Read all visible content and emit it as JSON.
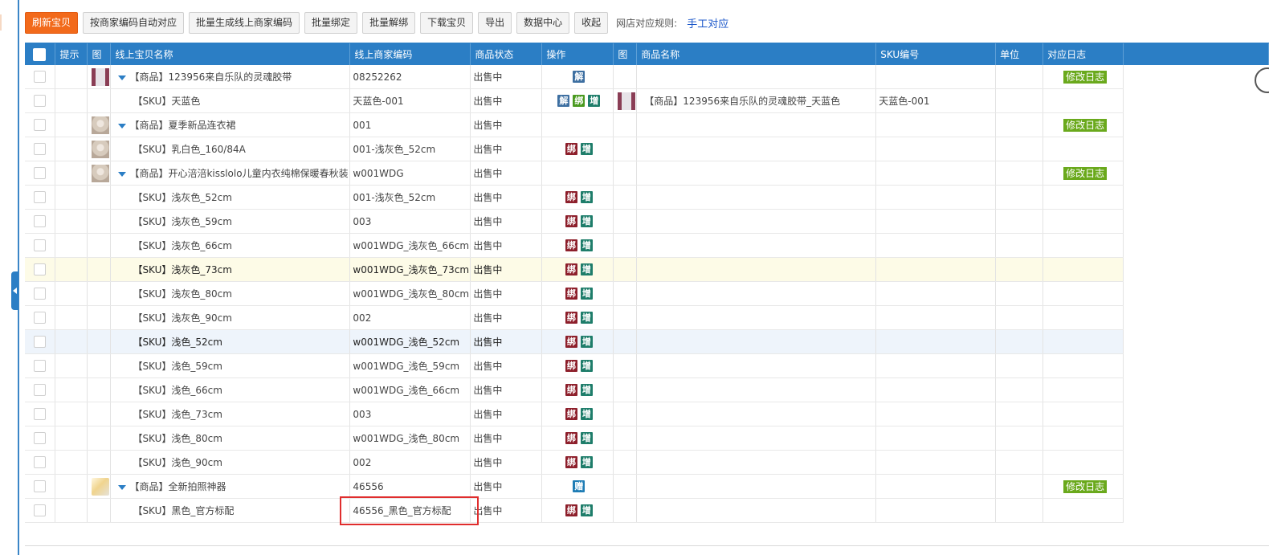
{
  "toolbar": {
    "refresh": "刷新宝贝",
    "auto_match": "按商家编码自动对应",
    "batch_generate": "批量生成线上商家编码",
    "batch_bind": "批量绑定",
    "batch_unbind": "批量解绑",
    "download": "下载宝贝",
    "export": "导出",
    "data_center": "数据中心",
    "collapse": "收起",
    "rule_label": "网店对应规则:",
    "rule_link": "手工对应"
  },
  "columns": [
    "提示",
    "图",
    "线上宝贝名称",
    "线上商家编码",
    "商品状态",
    "操作",
    "图",
    "商品名称",
    "SKU编号",
    "单位",
    "对应日志"
  ],
  "ops_labels": {
    "unbind": "解",
    "bind": "绑",
    "add": "增",
    "gift": "赠"
  },
  "log_label": "修改日志",
  "rows": [
    {
      "type": "product",
      "thumb": "tape",
      "name": "【商品】123956来自乐队的灵魂胶带",
      "code": "08252262",
      "status": "出售中",
      "ops": [
        "unbind"
      ],
      "pname": "",
      "sku": "",
      "log": true
    },
    {
      "type": "sku",
      "thumb": "",
      "name": "【SKU】天蓝色",
      "code": "天蓝色-001",
      "status": "出售中",
      "ops": [
        "unbind",
        "bind-green",
        "add"
      ],
      "pthumb": "tape",
      "pname": "【商品】123956来自乐队的灵魂胶带_天蓝色",
      "sku": "天蓝色-001",
      "log": false
    },
    {
      "type": "product",
      "thumb": "dress",
      "name": "【商品】夏季新品连衣裙",
      "code": "001",
      "status": "出售中",
      "ops": [],
      "pname": "",
      "sku": "",
      "log": true
    },
    {
      "type": "sku",
      "thumb": "dress",
      "name": "【SKU】乳白色_160/84A",
      "code": "001-浅灰色_52cm",
      "status": "出售中",
      "ops": [
        "bind",
        "add"
      ],
      "pname": "",
      "sku": "",
      "log": false
    },
    {
      "type": "product",
      "thumb": "dress",
      "name": "【商品】开心涪涪kisslolo儿童内衣纯棉保暖春秋装",
      "code": "w001WDG",
      "status": "出售中",
      "ops": [],
      "pname": "",
      "sku": "",
      "log": true
    },
    {
      "type": "sku",
      "thumb": "",
      "name": "【SKU】浅灰色_52cm",
      "code": "001-浅灰色_52cm",
      "status": "出售中",
      "ops": [
        "bind",
        "add"
      ],
      "pname": "",
      "sku": "",
      "log": false
    },
    {
      "type": "sku",
      "thumb": "",
      "name": "【SKU】浅灰色_59cm",
      "code": "003",
      "status": "出售中",
      "ops": [
        "bind",
        "add"
      ],
      "pname": "",
      "sku": "",
      "log": false
    },
    {
      "type": "sku",
      "thumb": "",
      "name": "【SKU】浅灰色_66cm",
      "code": "w001WDG_浅灰色_66cm",
      "status": "出售中",
      "ops": [
        "bind",
        "add"
      ],
      "pname": "",
      "sku": "",
      "log": false
    },
    {
      "type": "sku",
      "thumb": "",
      "name": "【SKU】浅灰色_73cm",
      "code": "w001WDG_浅灰色_73cm",
      "status": "出售中",
      "ops": [
        "bind",
        "add"
      ],
      "pname": "",
      "sku": "",
      "log": false,
      "state": "yellow"
    },
    {
      "type": "sku",
      "thumb": "",
      "name": "【SKU】浅灰色_80cm",
      "code": "w001WDG_浅灰色_80cm",
      "status": "出售中",
      "ops": [
        "bind",
        "add"
      ],
      "pname": "",
      "sku": "",
      "log": false
    },
    {
      "type": "sku",
      "thumb": "",
      "name": "【SKU】浅灰色_90cm",
      "code": "002",
      "status": "出售中",
      "ops": [
        "bind",
        "add"
      ],
      "pname": "",
      "sku": "",
      "log": false
    },
    {
      "type": "sku",
      "thumb": "",
      "name": "【SKU】浅色_52cm",
      "code": "w001WDG_浅色_52cm",
      "status": "出售中",
      "ops": [
        "bind",
        "add"
      ],
      "pname": "",
      "sku": "",
      "log": false,
      "state": "blue"
    },
    {
      "type": "sku",
      "thumb": "",
      "name": "【SKU】浅色_59cm",
      "code": "w001WDG_浅色_59cm",
      "status": "出售中",
      "ops": [
        "bind",
        "add"
      ],
      "pname": "",
      "sku": "",
      "log": false
    },
    {
      "type": "sku",
      "thumb": "",
      "name": "【SKU】浅色_66cm",
      "code": "w001WDG_浅色_66cm",
      "status": "出售中",
      "ops": [
        "bind",
        "add"
      ],
      "pname": "",
      "sku": "",
      "log": false
    },
    {
      "type": "sku",
      "thumb": "",
      "name": "【SKU】浅色_73cm",
      "code": "003",
      "status": "出售中",
      "ops": [
        "bind",
        "add"
      ],
      "pname": "",
      "sku": "",
      "log": false
    },
    {
      "type": "sku",
      "thumb": "",
      "name": "【SKU】浅色_80cm",
      "code": "w001WDG_浅色_80cm",
      "status": "出售中",
      "ops": [
        "bind",
        "add"
      ],
      "pname": "",
      "sku": "",
      "log": false
    },
    {
      "type": "sku",
      "thumb": "",
      "name": "【SKU】浅色_90cm",
      "code": "002",
      "status": "出售中",
      "ops": [
        "bind",
        "add"
      ],
      "pname": "",
      "sku": "",
      "log": false
    },
    {
      "type": "product",
      "thumb": "phone",
      "name": "【商品】全新拍照神器",
      "code": "46556",
      "status": "出售中",
      "ops": [
        "gift"
      ],
      "pname": "",
      "sku": "",
      "log": true
    },
    {
      "type": "sku",
      "thumb": "",
      "name": "【SKU】黑色_官方标配",
      "code": "46556_黑色_官方标配",
      "status": "出售中",
      "ops": [
        "bind",
        "add"
      ],
      "pname": "",
      "sku": "",
      "log": false
    }
  ],
  "colors": {
    "accent": "#2b7ec5",
    "primary_button": "#f26a1b",
    "log_badge": "#6aa91c",
    "highlight": "#e02d2d"
  }
}
